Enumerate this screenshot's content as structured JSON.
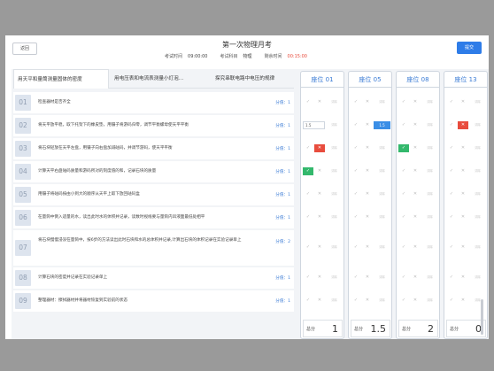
{
  "header": {
    "back_label": "返回",
    "title": "第一次物理月考",
    "submit_label": "提交",
    "exam_time_label": "考试时间",
    "exam_time": "09:00:00",
    "subject_label": "考试科目",
    "subject": "物理",
    "remaining_label": "剩余时间",
    "remaining": "00:15:00"
  },
  "tabs": [
    {
      "label": "用天平和量筒测量固体的密度"
    },
    {
      "label": "用电压表和电流表测量小灯泡…"
    },
    {
      "label": "探究串联电路中电压的规律"
    }
  ],
  "questions": [
    {
      "num": "01",
      "text": "检查器材是否齐全",
      "score": "分值：1"
    },
    {
      "num": "02",
      "text": "将天平放平稳，取下托架下的橡皮垫，用镊子将游码归零，调节平衡螺母使天平平衡",
      "score": "分值：1"
    },
    {
      "num": "03",
      "text": "将石块轻放在天平左盘，用镊子向右盘加减砝码，并调节游码，使天平平衡",
      "score": "分值：1"
    },
    {
      "num": "04",
      "text": "计算天平右盘砝码质量和游码所对的刻度值的和，记录石块的质量",
      "score": "分值：1"
    },
    {
      "num": "05",
      "text": "用镊子将砝码按由小到大的顺序从天平上取下放回砝码盒",
      "score": "分值：1"
    },
    {
      "num": "06",
      "text": "在量筒中倒入适量的水，读出此时水的体积并记录，读数时视线要与量筒内凹液面最低处相平",
      "score": "分值：1"
    },
    {
      "num": "07",
      "text": "将石块慢慢浸没在量筒中，按6步的方法读出此时石块和水的总体积并记录,计算出石块的体积记录在实验记录单上",
      "score": "分值：2"
    },
    {
      "num": "08",
      "text": "计算石块的密度并记录在实验记录单上",
      "score": "分值：1"
    },
    {
      "num": "09",
      "text": "整理器材：擦拭器材并将器材恢复到实验前的状态",
      "score": "分值：1"
    }
  ],
  "seat_mark_label": "清除",
  "total_label": "总分",
  "seats": [
    {
      "title": "座位 01",
      "total": "1",
      "rows": [
        "none",
        "input:1.5",
        "red",
        "green",
        "none",
        "none",
        "none",
        "none",
        "none"
      ]
    },
    {
      "title": "座位 05",
      "total": "1.5",
      "rows": [
        "none",
        "blue:1.5",
        "none",
        "none",
        "none",
        "none",
        "none",
        "none",
        "none"
      ]
    },
    {
      "title": "座位 08",
      "total": "2",
      "rows": [
        "none",
        "none",
        "green",
        "none",
        "none",
        "none",
        "none",
        "none",
        "none"
      ]
    },
    {
      "title": "座位 13",
      "total": "0",
      "rows": [
        "none",
        "red",
        "none",
        "none",
        "none",
        "none",
        "none",
        "none",
        "none"
      ]
    }
  ],
  "colors": {
    "accent": "#2e7ce8",
    "red": "#e84c3d",
    "green": "#33b86c"
  }
}
